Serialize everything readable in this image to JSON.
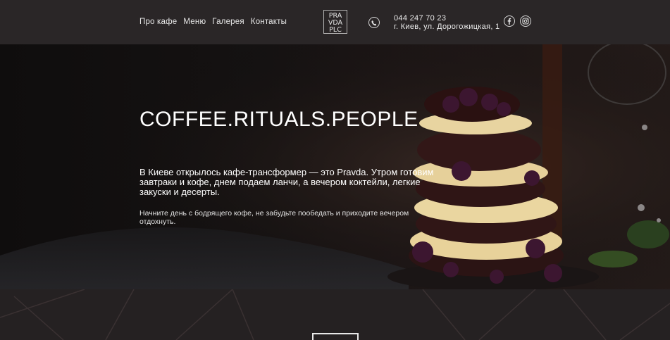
{
  "nav": {
    "items": [
      "Про кафе",
      "Меню",
      "Галерея",
      "Контакты"
    ]
  },
  "logo": {
    "text_lines": [
      "PRA",
      "VDA",
      "PLC"
    ]
  },
  "contact": {
    "phone": "044 247 70 23",
    "address": "г. Киев, ул. Дорогожицкая, 1"
  },
  "social": {
    "facebook_icon": "facebook-icon",
    "instagram_icon": "instagram-icon"
  },
  "hero": {
    "title": "COFFEE.RITUALS.PEOPLE",
    "lead": "В Киеве открылось кафе-трансформер — это Pravda. Утром готовим завтраки и кофе, днем подаем ланчи, а вечером коктейли, легкие закуски и десерты.",
    "sub": "Начните день с бодрящего кофе, не забудьте пообедать и приходите вечером отдохнуть."
  },
  "colors": {
    "header_bg": "#2a2627",
    "page_bg": "#252122",
    "text": "#ffffff"
  }
}
